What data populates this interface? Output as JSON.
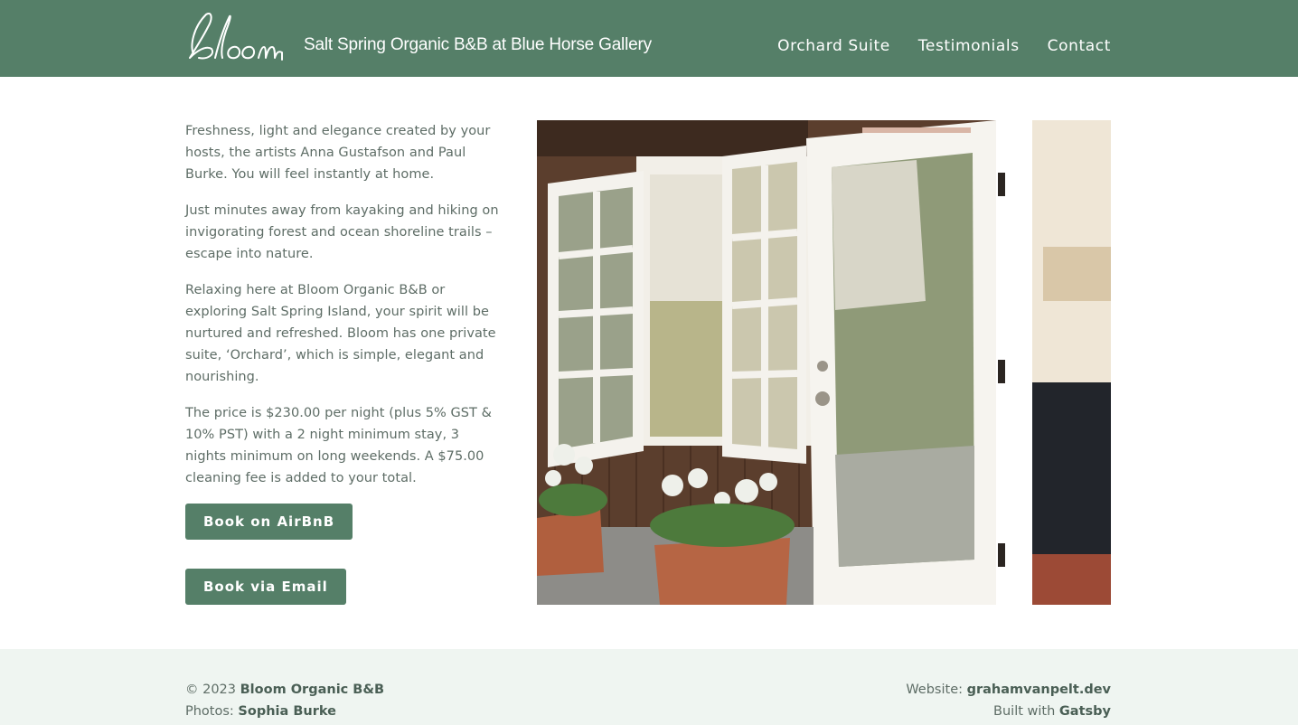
{
  "header": {
    "logo_text": "bloom",
    "tagline": "Salt Spring Organic B&B at Blue Horse Gallery",
    "nav": [
      "Orchard Suite",
      "Testimonials",
      "Contact"
    ]
  },
  "intro": {
    "paragraphs": [
      "Freshness, light and elegance created by your hosts, the artists Anna Gustafson and Paul Burke. You will feel instantly at home.",
      "Just minutes away from kayaking and hiking on invigorating forest and ocean shoreline trails – escape into nature.",
      "Relaxing here at Bloom Organic B&B or exploring Salt Spring Island, your spirit will be nurtured and refreshed. Bloom has one private suite, ‘Orchard’, which is simple, elegant and nourishing.",
      "The price is $230.00 per night (plus 5% GST & 10% PST) with a 2 night minimum stay, 3 nights minimum on long weekends. A $75.00 cleaning fee is added to your total."
    ],
    "book_airbnb": "Book on AirBnB",
    "book_email": "Book via Email"
  },
  "photo": {
    "alt": "French doors of the Orchard Suite opening onto a garden with geranium planters"
  },
  "footer": {
    "copyright_prefix": "© 2023 ",
    "copyright_name": "Bloom Organic B&B",
    "photos_prefix": "Photos: ",
    "photos_name": "Sophia Burke",
    "website_prefix": "Website: ",
    "website_link": "grahamvanpelt.dev",
    "built_prefix": "Built with ",
    "built_link": "Gatsby"
  },
  "colors": {
    "brand_green": "#557f68",
    "footer_bg": "#eff5f1",
    "text": "#5e6d66"
  }
}
